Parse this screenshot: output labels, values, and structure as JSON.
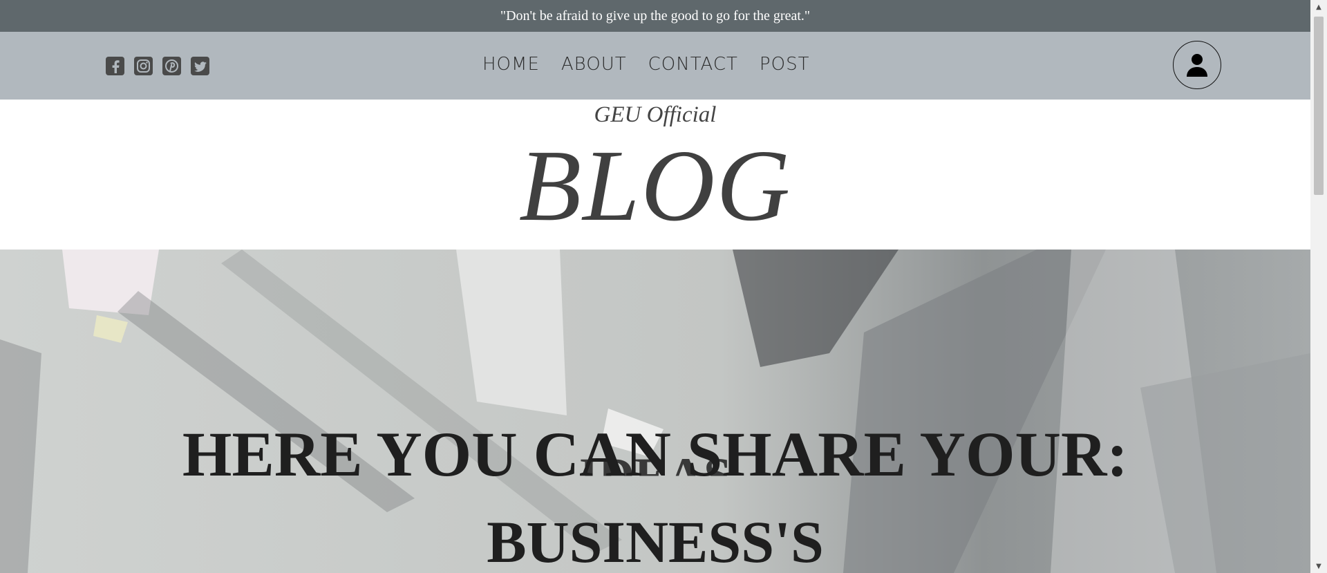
{
  "quote_bar": {
    "text": "\"Don't be afraid to give up the good to go for the great.\""
  },
  "socials": [
    {
      "icon": "facebook-icon"
    },
    {
      "icon": "instagram-icon"
    },
    {
      "icon": "pinterest-icon"
    },
    {
      "icon": "twitter-icon"
    }
  ],
  "nav": {
    "home": "HOME",
    "about": "ABOUT",
    "contact": "CONTACT",
    "post": "POST"
  },
  "user_button": {
    "icon": "user-icon"
  },
  "header": {
    "subtitle": "GEU Official",
    "title": "BLOG"
  },
  "hero": {
    "headline": "HERE YOU CAN SHARE YOUR:",
    "words": [
      "IDEAS",
      "BUSINESS'S"
    ]
  },
  "colors": {
    "quote_bar_bg": "#5f686c",
    "navbar_bg": "#b1b8be",
    "title_color": "#404040",
    "hero_text": "#1f1f1f"
  }
}
